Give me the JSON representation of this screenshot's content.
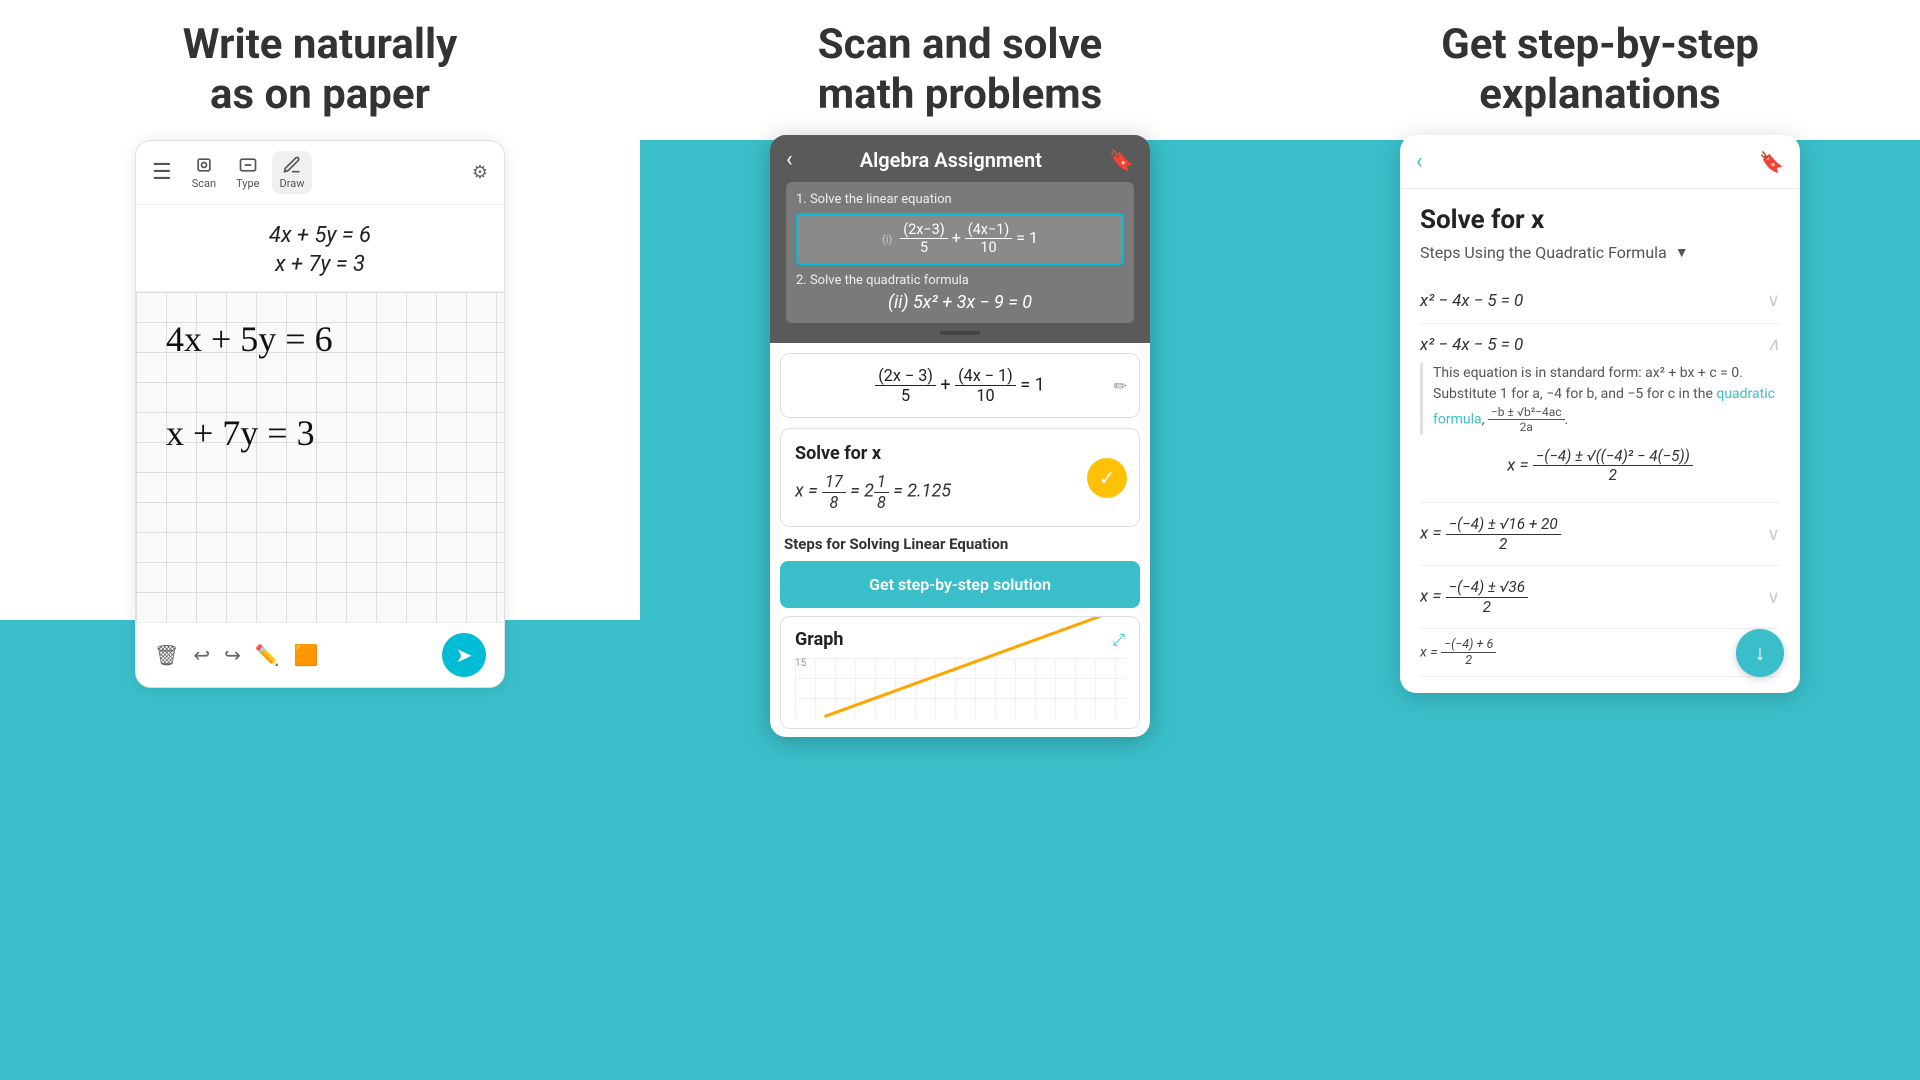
{
  "header": {
    "col1": "Write naturally\nas on paper",
    "col2": "Scan and solve\nmath problems",
    "col3": "Get step-by-step\nexplanations"
  },
  "left": {
    "toolbar": {
      "scan_label": "Scan",
      "type_label": "Type",
      "draw_label": "Draw"
    },
    "equations": {
      "eq1": "4x + 5y = 6",
      "eq2": "x + 7y = 3"
    },
    "handwritten": {
      "eq1": "4x + 5y = 6",
      "eq2": "x + 7y = 3"
    }
  },
  "middle": {
    "title": "Algebra Assignment",
    "problem1_label": "1. Solve the linear equation",
    "problem1_eq": "(2x−3)/5 + (4x−1)/10 = 1",
    "problem2_label": "2. Solve the quadratic formula",
    "problem2_eq": "5x² + 3x − 9 = 0",
    "solve_for": "Solve for x",
    "equation_display": "(2x − 3)/5 + (4x − 1)/10 = 1",
    "result": "x = 17/8 = 2 1/8 = 2.125",
    "steps_label": "Steps for Solving Linear Equation",
    "step_btn": "Get step-by-step solution",
    "graph_title": "Graph",
    "graph_label": "15"
  },
  "right": {
    "title": "Solve for x",
    "steps_header": "Steps Using the Quadratic Formula",
    "step1_math": "x² − 4x − 5 = 0",
    "step2_math": "x² − 4x − 5 = 0",
    "explanation": "This equation is in standard form: ax² + bx + c = 0. Substitute 1 for a, −4 for b, and −5 for c in the",
    "quadratic_formula_link": "quadratic formula",
    "formula_suffix": ",",
    "formula_math": "−b ± √(b²−4ac) / 2a",
    "step3_math": "x = (−(−4) ± √((−4)² − 4(−5))) / 2",
    "step4_math": "x = (−(−4) ± √(16 + 20)) / 2",
    "step5_math": "x = (−(−4) ± √36) / 2",
    "step6_math": "x = (−(−4) + 6) / 2"
  }
}
